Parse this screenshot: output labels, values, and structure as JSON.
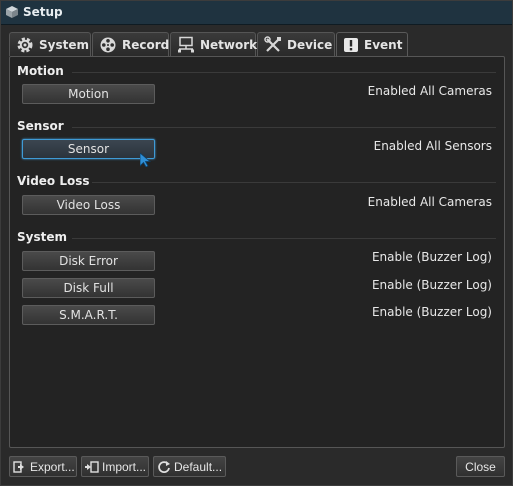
{
  "window": {
    "title": "Setup"
  },
  "tabs": [
    {
      "label": "System",
      "icon": "gear-icon",
      "active": false
    },
    {
      "label": "Record",
      "icon": "film-reel-icon",
      "active": false
    },
    {
      "label": "Network",
      "icon": "network-icon",
      "active": false
    },
    {
      "label": "Device",
      "icon": "tools-icon",
      "active": false
    },
    {
      "label": "Event",
      "icon": "exclamation-icon",
      "active": true
    }
  ],
  "sections": {
    "motion": {
      "title": "Motion",
      "button": "Motion",
      "status": "Enabled All Cameras"
    },
    "sensor": {
      "title": "Sensor",
      "button": "Sensor",
      "status": "Enabled All Sensors"
    },
    "video_loss": {
      "title": "Video Loss",
      "button": "Video Loss",
      "status": "Enabled All Cameras"
    },
    "system": {
      "title": "System",
      "items": [
        {
          "button": "Disk Error",
          "status": "Enable (Buzzer Log)"
        },
        {
          "button": "Disk Full",
          "status": "Enable (Buzzer Log)"
        },
        {
          "button": "S.M.A.R.T.",
          "status": "Enable (Buzzer Log)"
        }
      ]
    }
  },
  "footer": {
    "export": "Export...",
    "import": "Import...",
    "default": "Default...",
    "close": "Close"
  },
  "colors": {
    "accent": "#3f9bd6",
    "titlebar": "#1f3340"
  }
}
